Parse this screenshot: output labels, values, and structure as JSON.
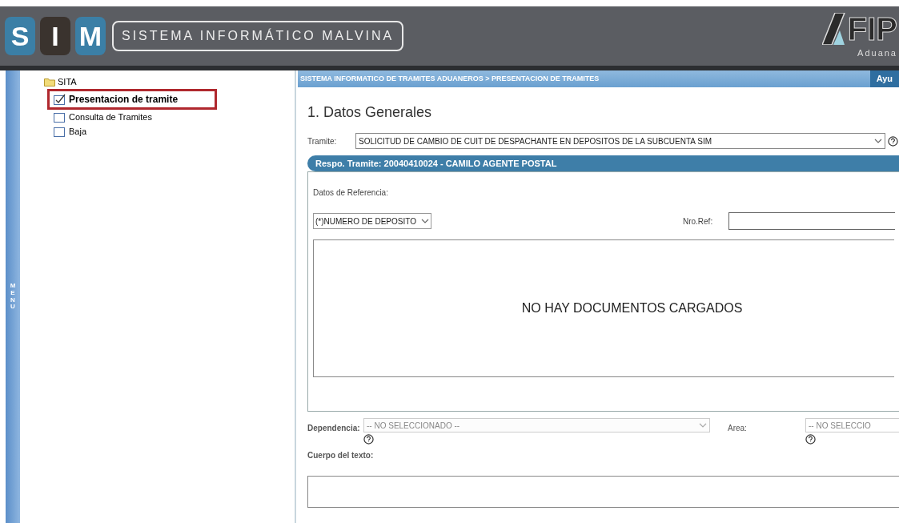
{
  "header": {
    "logo_letters": [
      {
        "letter": "S",
        "color": "#3b7fa6"
      },
      {
        "letter": "I",
        "color": "#3a332e"
      },
      {
        "letter": "M",
        "color": "#3b7fa6"
      }
    ],
    "title": "SISTEMA INFORMÁTICO MALVINA",
    "brand": "FIP",
    "brand_subtitle": "Aduana"
  },
  "side_menu": {
    "label": "MENU"
  },
  "tree": {
    "label": "SITA",
    "children": [
      {
        "label": "Presentacion de tramite",
        "selected": true
      },
      {
        "label": "Consulta de Tramites",
        "selected": false
      },
      {
        "label": "Baja",
        "selected": false
      }
    ]
  },
  "breadcrumb": "SISTEMA INFORMATICO DE TRAMITES ADUANEROS > PRESENTACION DE TRAMITES",
  "help_button": "Ayu",
  "section_title": "1. Datos Generales",
  "tramite": {
    "label": "Tramite:",
    "value": "SOLICITUD DE CAMBIO DE CUIT DE DESPACHANTE EN DEPOSITOS DE LA SUBCUENTA SIM"
  },
  "responsable": "Respo. Tramite: 20040410024 - CAMILO AGENTE POSTAL",
  "referencia": {
    "label": "Datos de Referencia:",
    "type_value": "(*)NUMERO DE DEPOSITO",
    "nro_label": "Nro.Ref:",
    "empty_message": "NO HAY DOCUMENTOS CARGADOS"
  },
  "dependencia": {
    "label": "Dependencia:",
    "value": "-- NO SELECCIONADO --",
    "disabled": true
  },
  "area": {
    "label": "Area:",
    "value": "-- NO SELECCIO"
  },
  "cuerpo": {
    "label": "Cuerpo del texto:"
  }
}
